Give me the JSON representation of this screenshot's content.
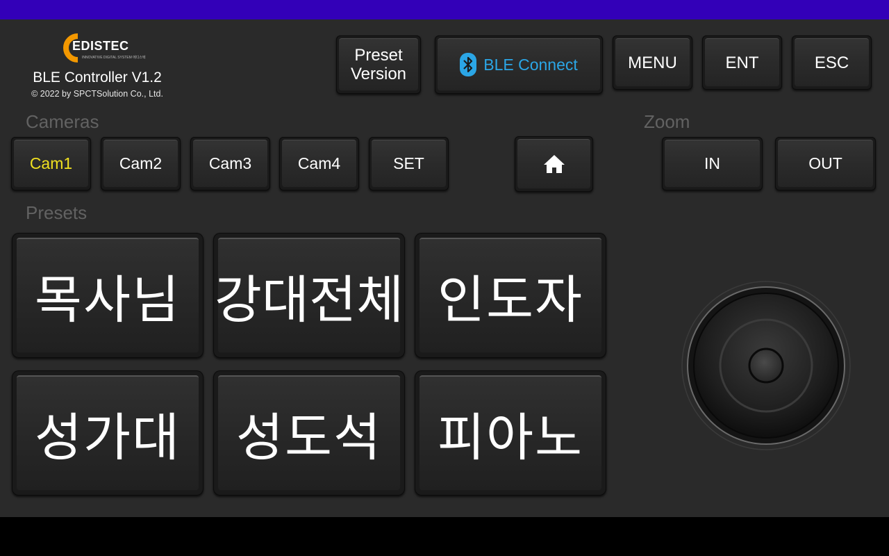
{
  "brand": {
    "logo_text": "EDISTEC",
    "logo_subtext": "INNOVATIVE DIGITAL SYSTEM 에디스텍",
    "app_title": "BLE Controller V1.2",
    "copyright": "© 2022 by SPCTSolution Co., Ltd."
  },
  "toolbar": {
    "preset_version_line1": "Preset",
    "preset_version_line2": "Version",
    "ble_connect": "BLE Connect",
    "menu": "MENU",
    "ent": "ENT",
    "esc": "ESC"
  },
  "cameras": {
    "label": "Cameras",
    "items": [
      {
        "label": "Cam1",
        "selected": true
      },
      {
        "label": "Cam2",
        "selected": false
      },
      {
        "label": "Cam3",
        "selected": false
      },
      {
        "label": "Cam4",
        "selected": false
      }
    ],
    "set": "SET",
    "home_icon": "home-icon"
  },
  "zoom": {
    "label": "Zoom",
    "in": "IN",
    "out": "OUT"
  },
  "presets": {
    "label": "Presets",
    "items": [
      "목사님",
      "강대전체",
      "인도자",
      "성가대",
      "성도석",
      "피아노"
    ]
  },
  "colors": {
    "status_bar": "#3300b8",
    "background": "#2a2a2a",
    "selected_text": "#f0e020",
    "ble_accent": "#2ba6e6",
    "logo_orange": "#f39800"
  }
}
